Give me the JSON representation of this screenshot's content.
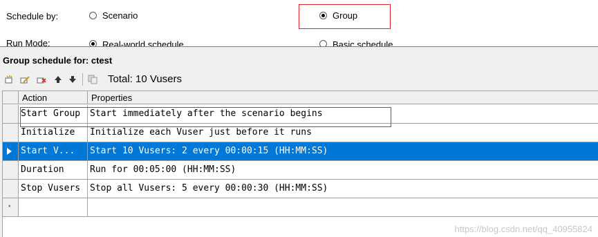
{
  "top": {
    "schedule_by_label": "Schedule by:",
    "scenario_option": "Scenario",
    "group_option": "Group",
    "run_mode_label": "Run Mode:",
    "real_world_option": "Real-world schedule",
    "basic_option": "Basic schedule"
  },
  "panel": {
    "title": "Group schedule for: ctest",
    "total_label": "Total: 10 Vusers"
  },
  "toolbar_icons": [
    "new-action-icon",
    "edit-action-icon",
    "delete-action-icon",
    "move-up-icon",
    "move-down-icon",
    "copy-icon"
  ],
  "grid": {
    "columns": [
      "Action",
      "Properties"
    ],
    "rows": [
      {
        "action": "Start Group",
        "properties": "Start immediately after the scenario begins"
      },
      {
        "action": "Initialize",
        "properties": "Initialize each Vuser just before it runs"
      },
      {
        "action": "Start  V...",
        "properties": "Start 10 Vusers: 2 every 00:00:15 (HH:MM:SS)"
      },
      {
        "action": "Duration",
        "properties": "Run for 00:05:00 (HH:MM:SS)"
      },
      {
        "action": "Stop Vusers",
        "properties": "Stop all Vusers: 5 every 00:00:30 (HH:MM:SS)"
      }
    ],
    "new_row_marker": "*"
  },
  "colors": {
    "selection": "#0078d7",
    "highlight": "#e8202a"
  },
  "watermark": "https://blog.csdn.net/qq_40955824"
}
